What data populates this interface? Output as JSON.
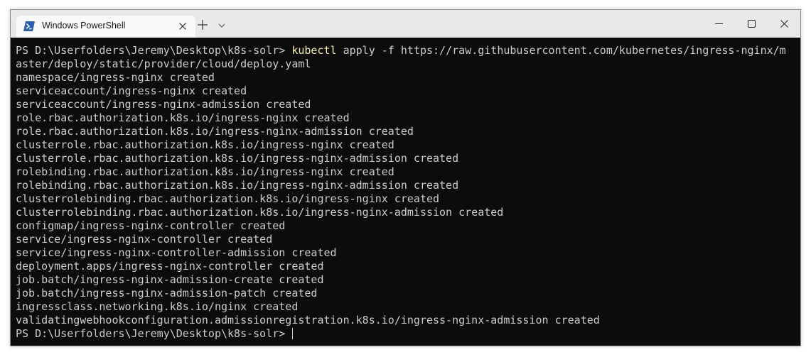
{
  "window": {
    "tab_title": "Windows PowerShell",
    "tab_icon": "powershell-icon",
    "new_tab_icon": "plus-icon",
    "dropdown_icon": "chevron-down-icon",
    "controls": [
      "minimize-icon",
      "maximize-icon",
      "close-icon"
    ]
  },
  "colors": {
    "terminal_bg": "#0c0c0c",
    "terminal_text": "#cccccc",
    "command_highlight": "#f9f1a5",
    "titlebar_bg": "#e9e9e9",
    "tab_bg": "#f9f9f9",
    "powershell_icon": "#2a5fb0"
  },
  "terminal": {
    "prompt_1": "PS D:\\Userfolders\\Jeremy\\Desktop\\k8s-solr> ",
    "command_name": "kubectl",
    "command_args": " apply -f https://raw.githubusercontent.com/kubernetes/ingress-nginx/m",
    "command_wrap": "aster/deploy/static/provider/cloud/deploy.yaml",
    "output": [
      "namespace/ingress-nginx created",
      "serviceaccount/ingress-nginx created",
      "serviceaccount/ingress-nginx-admission created",
      "role.rbac.authorization.k8s.io/ingress-nginx created",
      "role.rbac.authorization.k8s.io/ingress-nginx-admission created",
      "clusterrole.rbac.authorization.k8s.io/ingress-nginx created",
      "clusterrole.rbac.authorization.k8s.io/ingress-nginx-admission created",
      "rolebinding.rbac.authorization.k8s.io/ingress-nginx created",
      "rolebinding.rbac.authorization.k8s.io/ingress-nginx-admission created",
      "clusterrolebinding.rbac.authorization.k8s.io/ingress-nginx created",
      "clusterrolebinding.rbac.authorization.k8s.io/ingress-nginx-admission created",
      "configmap/ingress-nginx-controller created",
      "service/ingress-nginx-controller created",
      "service/ingress-nginx-controller-admission created",
      "deployment.apps/ingress-nginx-controller created",
      "job.batch/ingress-nginx-admission-create created",
      "job.batch/ingress-nginx-admission-patch created",
      "ingressclass.networking.k8s.io/nginx created",
      "validatingwebhookconfiguration.admissionregistration.k8s.io/ingress-nginx-admission created"
    ],
    "prompt_2": "PS D:\\Userfolders\\Jeremy\\Desktop\\k8s-solr> "
  }
}
